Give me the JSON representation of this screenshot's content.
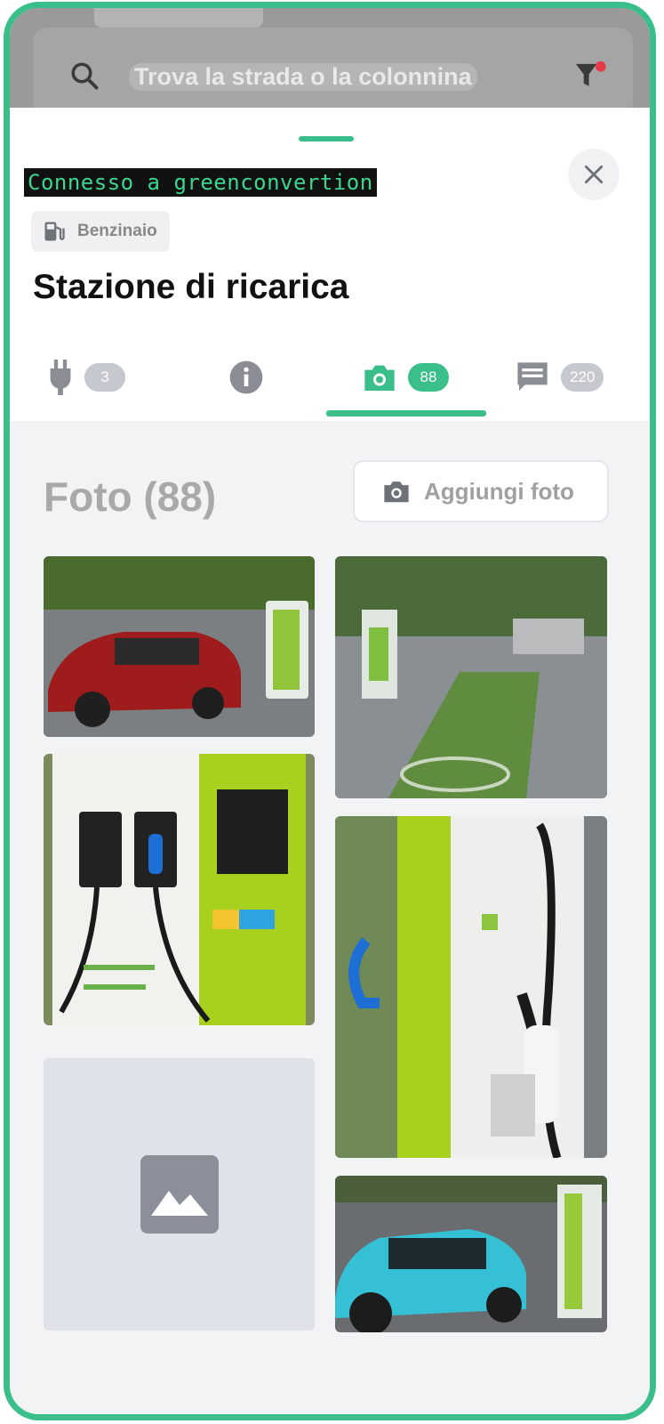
{
  "search": {
    "placeholder": "Trova la strada o la colonnina",
    "search_icon": "search-icon",
    "filter_icon": "filter-icon",
    "filter_badge_color": "#e63946"
  },
  "sheet": {
    "connection_status": "Connesso a greenconvertion",
    "category": "Benzinaio",
    "category_icon": "fuel-pump-icon",
    "title": "Stazione di ricarica",
    "close_icon": "close-icon"
  },
  "tabs": [
    {
      "icon": "plug-icon",
      "count": "3",
      "active": false
    },
    {
      "icon": "info-icon",
      "count": null,
      "active": false
    },
    {
      "icon": "camera-icon",
      "count": "88",
      "active": true
    },
    {
      "icon": "comment-icon",
      "count": "220",
      "active": false
    }
  ],
  "photos": {
    "section_title": "Foto (88)",
    "add_button_label": "Aggiungi foto",
    "items": [
      {
        "name": "photo-red-car-charging"
      },
      {
        "name": "photo-charging-parking-space"
      },
      {
        "name": "photo-charging-station-closeup"
      },
      {
        "name": "photo-charger-cable-side"
      },
      {
        "name": "photo-placeholder-image-icon"
      },
      {
        "name": "photo-blue-car-charging"
      }
    ]
  },
  "colors": {
    "accent": "#3bbf8a",
    "muted_text": "#a9a9a9",
    "pill_gray": "#c5c8ce"
  }
}
